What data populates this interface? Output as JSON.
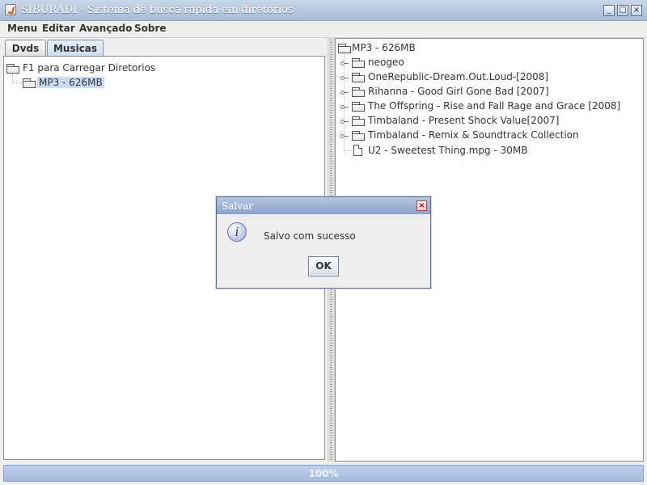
{
  "window": {
    "title": "SIBURADI - Sistema de busca rapida em diretorios"
  },
  "menubar": {
    "items": [
      "Menu",
      "Editar",
      "Avançado",
      "Sobre"
    ]
  },
  "left_panel": {
    "tabs": [
      {
        "label": "Dvds",
        "active": false
      },
      {
        "label": "Musicas",
        "active": true
      }
    ],
    "tree": {
      "root": "F1 para Carregar Diretorios",
      "child": "MP3 - 626MB",
      "selected": "MP3 - 626MB"
    }
  },
  "right_panel": {
    "tree_root": "MP3 - 626MB",
    "items": [
      {
        "label": "neogeo",
        "type": "folder"
      },
      {
        "label": "OneRepublic-Dream.Out.Loud-[2008]",
        "type": "folder"
      },
      {
        "label": "Rihanna - Good Girl Gone Bad [2007]",
        "type": "folder"
      },
      {
        "label": "The Offspring - Rise and Fall Rage and Grace [2008]",
        "type": "folder"
      },
      {
        "label": "Timbaland - Present Shock Value[2007]",
        "type": "folder"
      },
      {
        "label": "Timbaland - Remix & Soundtrack Collection",
        "type": "folder"
      },
      {
        "label": "U2 - Sweetest Thing.mpg - 30MB",
        "type": "file"
      }
    ]
  },
  "statusbar": {
    "progress_percent": 100,
    "progress_text": "100%"
  },
  "dialog": {
    "title": "Salvar",
    "message": "Salvo com sucesso",
    "ok_label": "OK",
    "icon": "info-icon"
  }
}
